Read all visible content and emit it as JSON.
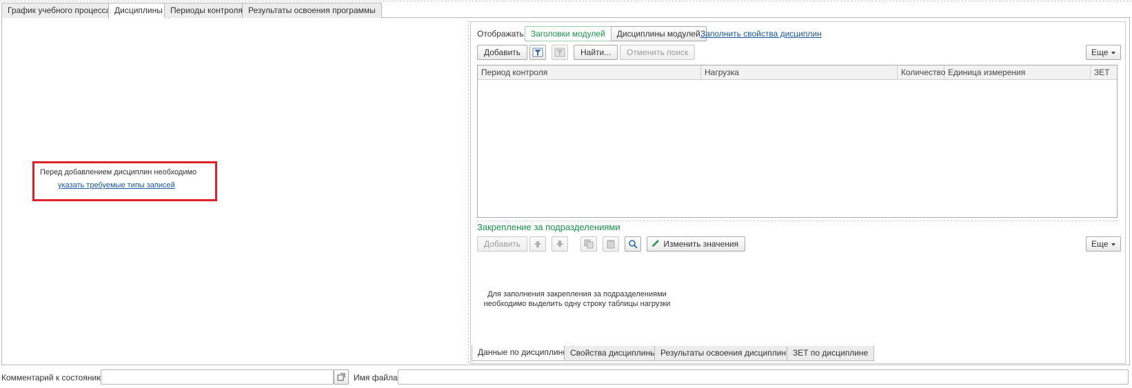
{
  "top_tabs": [
    {
      "label": "График учебного процесса",
      "active": false
    },
    {
      "label": "Дисциплины",
      "active": true
    },
    {
      "label": "Периоды контроля",
      "active": false
    },
    {
      "label": "Результаты освоения программы",
      "active": false
    }
  ],
  "left_panel": {
    "notice_text": "Перед добавлением дисциплин необходимо",
    "notice_link": "указать требуемые типы записей",
    "highlight_color": "#e0202a"
  },
  "display_bar": {
    "label": "Отображать:",
    "toggle_headers": "Заголовки модулей",
    "toggle_disciplines": "Дисциплины модулей",
    "fill_link": "Заполнить свойства дисциплин"
  },
  "toolbar": {
    "add_label": "Добавить",
    "find_label": "Найти...",
    "cancel_search_label": "Отменить поиск",
    "more_label": "Еще"
  },
  "load_table": {
    "columns": [
      "Период контроля",
      "Нагрузка",
      "Количество",
      "Единица измерения",
      "ЗЕТ"
    ],
    "rows": []
  },
  "subdivisions": {
    "title": "Закрепление за подразделениями",
    "add_label": "Добавить",
    "change_values_label": "Изменить значения",
    "more_label": "Еще",
    "empty_message_line1": "Для заполнения закрепления за подразделениями",
    "empty_message_line2": "необходимо выделить одну строку таблицы нагрузки"
  },
  "bottom_tabs": [
    {
      "label": "Данные по дисциплине",
      "active": true
    },
    {
      "label": "Свойства дисциплины",
      "active": false
    },
    {
      "label": "Результаты освоения дисциплины",
      "active": false
    },
    {
      "label": "ЗЕТ по дисциплине",
      "active": false
    }
  ],
  "footer": {
    "comment_label": "Комментарий к состоянию:",
    "comment_value": "",
    "file_label": "Имя файла:",
    "file_value": ""
  },
  "colors": {
    "accent_green": "#18934a",
    "link_blue": "#1a55a8"
  }
}
